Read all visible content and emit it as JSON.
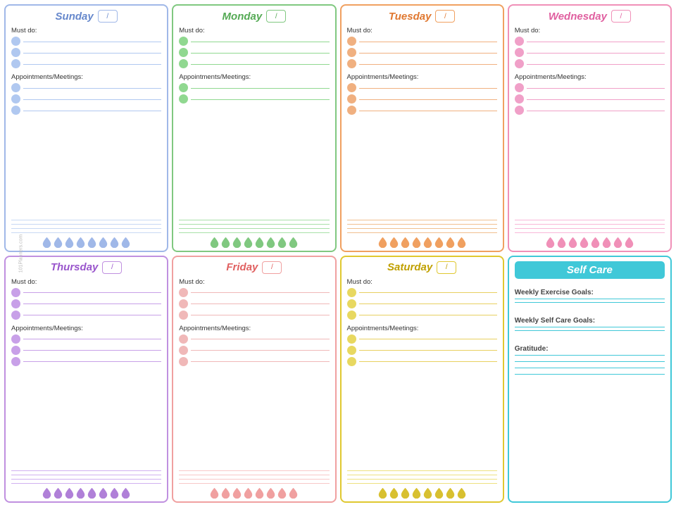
{
  "days": [
    {
      "id": "sunday",
      "class": "sunday",
      "title": "Sunday",
      "title_color": "#6688cc",
      "must_do_label": "Must do:",
      "appointments_label": "Appointments/Meetings:",
      "bullets": 3,
      "appt_bullets": 3,
      "notes_lines": 4,
      "water_drops": 8
    },
    {
      "id": "monday",
      "class": "monday",
      "title": "Monday",
      "title_color": "#55aa55",
      "must_do_label": "Must do:",
      "appointments_label": "Appointments/Meetings:",
      "bullets": 3,
      "appt_bullets": 2,
      "notes_lines": 4,
      "water_drops": 8
    },
    {
      "id": "tuesday",
      "class": "tuesday",
      "title": "Tuesday",
      "title_color": "#e07830",
      "must_do_label": "Must do:",
      "appointments_label": "Appointments/Meetings:",
      "bullets": 3,
      "appt_bullets": 3,
      "notes_lines": 4,
      "water_drops": 8
    },
    {
      "id": "wednesday",
      "class": "wednesday",
      "title": "Wednesday",
      "title_color": "#e060a0",
      "must_do_label": "Must do:",
      "appointments_label": "Appointments/Meetings:",
      "bullets": 3,
      "appt_bullets": 3,
      "notes_lines": 4,
      "water_drops": 8
    },
    {
      "id": "thursday",
      "class": "thursday",
      "title": "Thursday",
      "title_color": "#9955cc",
      "must_do_label": "Must do:",
      "appointments_label": "Appointments/Meetings:",
      "bullets": 3,
      "appt_bullets": 3,
      "notes_lines": 4,
      "water_drops": 8
    },
    {
      "id": "friday",
      "class": "friday",
      "title": "Friday",
      "title_color": "#e06060",
      "must_do_label": "Must do:",
      "appointments_label": "Appointments/Meetings:",
      "bullets": 3,
      "appt_bullets": 3,
      "notes_lines": 4,
      "water_drops": 8
    },
    {
      "id": "saturday",
      "class": "saturday",
      "title": "Saturday",
      "title_color": "#c0a000",
      "must_do_label": "Must do:",
      "appointments_label": "Appointments/Meetings:",
      "bullets": 3,
      "appt_bullets": 3,
      "notes_lines": 4,
      "water_drops": 8
    }
  ],
  "selfcare": {
    "title": "Self Care",
    "exercise_label": "Weekly Exercise Goals:",
    "selfcare_label": "Weekly Self Care Goals:",
    "gratitude_label": "Gratitude:",
    "lines_per_section": 2
  },
  "watermark": "101Planners.com",
  "slash": "/"
}
